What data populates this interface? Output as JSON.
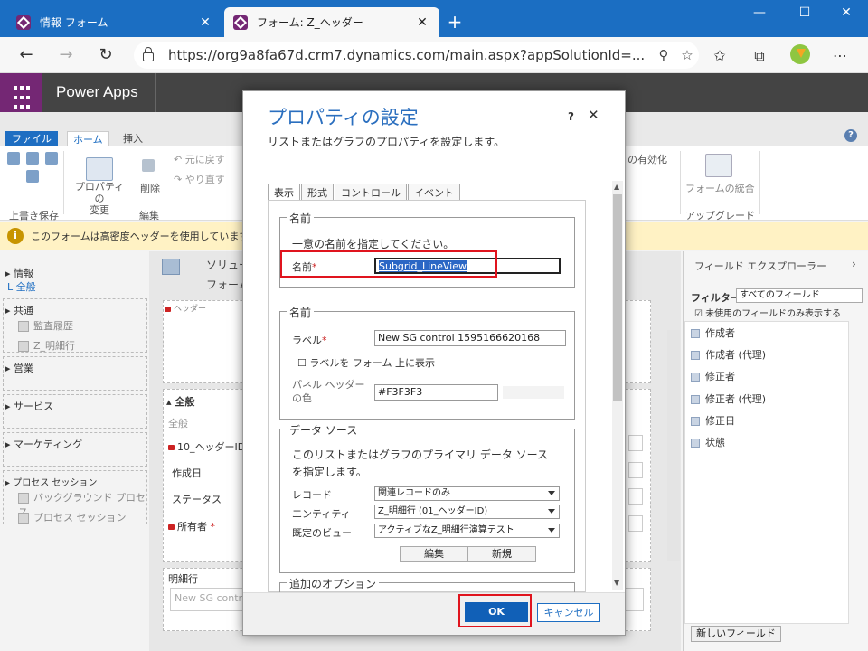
{
  "browser": {
    "tabs": [
      {
        "title": "情報 フォーム",
        "active": false
      },
      {
        "title": "フォーム: Z_ヘッダー",
        "active": true
      }
    ],
    "url": "https://org9a8fa67d.crm7.dynamics.com/main.aspx?appSolutionId=..."
  },
  "app": {
    "title": "Power Apps"
  },
  "ribbon": {
    "tabs": [
      "ファイル",
      "ホーム",
      "挿入"
    ],
    "save_group": "上書き保存",
    "edit_group": "編集",
    "properties": "プロパティの\n変更",
    "delete": "削除",
    "undo": "元に戻す",
    "redo": "やり直す",
    "enable": "の有効化",
    "merge": "フォームの統合",
    "upgrade": "アップグレード"
  },
  "notice": "このフォームは高密度ヘッダーを使用しています。このフォ",
  "leftnav": {
    "info": "情報",
    "all": "L 全般",
    "common": "共通",
    "audit": "監査履歴",
    "zdetail": "Z_明細行",
    "sales": "営業",
    "service": "サービス",
    "marketing": "マーケティング",
    "process": "プロセス セッション",
    "background": "バックグラウンド プロセス",
    "process_session": "プロセス セッション"
  },
  "canvas": {
    "solution": "ソリュー",
    "form": "フォーム",
    "header": "ヘッダー",
    "general": "全般",
    "general_sub": "全般",
    "fields": [
      "10_ヘッダーID",
      "作成日",
      "ステータス",
      "所有者"
    ],
    "detail_section": "明細行",
    "subgrid_preview": "New SG contr"
  },
  "rightpanel": {
    "title": "フィールド エクスプローラー",
    "filter_label": "フィルター",
    "filter_value": "すべてのフィールド",
    "unused_only": "未使用のフィールドのみ表示する",
    "fields": [
      "作成者",
      "作成者 (代理)",
      "修正者",
      "修正者 (代理)",
      "修正日",
      "状態"
    ],
    "new_field": "新しいフィールド"
  },
  "dialog": {
    "title": "プロパティの設定",
    "subtitle": "リストまたはグラフのプロパティを設定します。",
    "help": "?",
    "tabs": [
      "表示",
      "形式",
      "コントロール",
      "イベント"
    ],
    "name_group": {
      "legend": "名前",
      "hint": "一意の名前を指定してください。",
      "label": "名前",
      "value": "Subgrid_LineView"
    },
    "label_group": {
      "legend": "名前",
      "label_caption": "ラベル",
      "label_value": "New SG control 1595166620168",
      "show_label": "ラベルを フォーム 上に表示",
      "panel_header_color": "パネル ヘッダー\nの色",
      "color_value": "#F3F3F3"
    },
    "datasource": {
      "legend": "データ ソース",
      "description": "このリストまたはグラフのプライマリ データ ソース\nを指定します。",
      "records_label": "レコード",
      "records_value": "関連レコードのみ",
      "entity_label": "エンティティ",
      "entity_value": "Z_明細行 (01_ヘッダーID)",
      "view_label": "既定のビュー",
      "view_value": "アクティブなZ_明細行演算テスト",
      "edit_btn": "編集",
      "new_btn": "新規"
    },
    "more_options": "追加のオプション",
    "ok": "OK",
    "cancel": "キャンセル"
  },
  "colors": {
    "accent": "#1e6ec2",
    "brand": "#742774",
    "highlight": "#e0141e"
  }
}
